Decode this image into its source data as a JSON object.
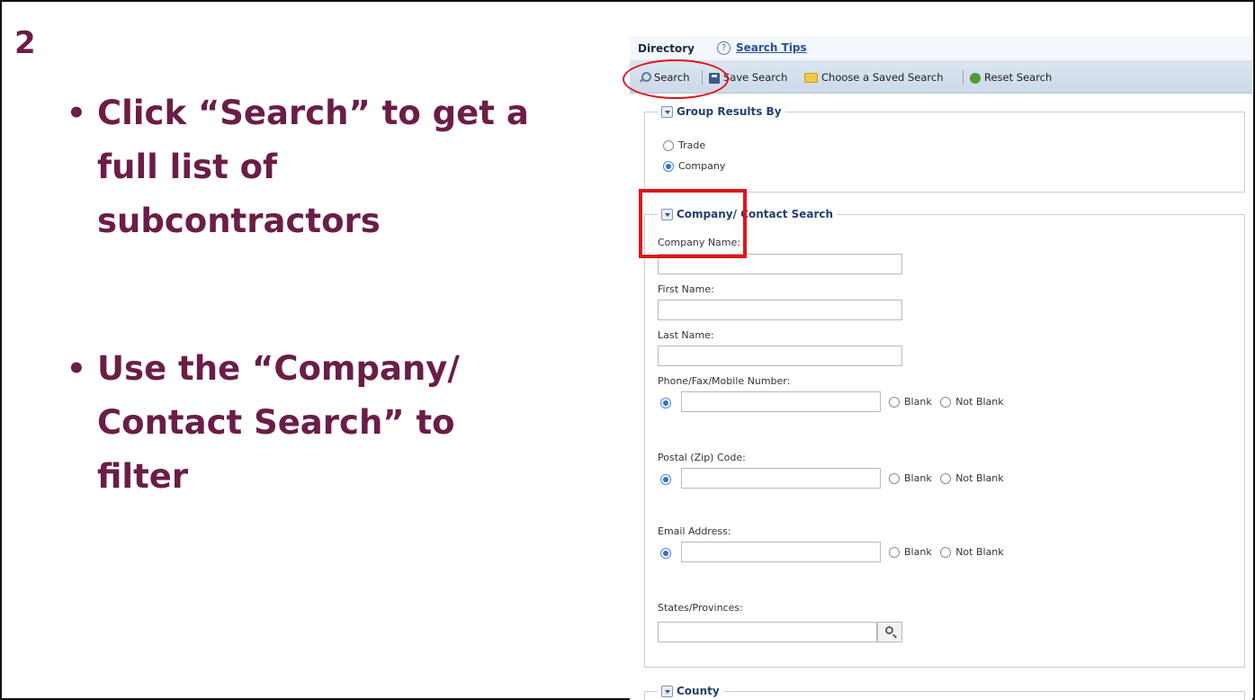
{
  "slide": {
    "step_number": "2",
    "bullets": [
      "Click “Search” to get a full list of subcontractors",
      "Use the “Company/ Contact Search” to filter"
    ]
  },
  "directory": {
    "title": "Directory",
    "tips_link": "Search Tips",
    "toolbar": {
      "search": "Search",
      "save_search": "Save Search",
      "choose_saved": "Choose a Saved Search",
      "reset_search": "Reset Search"
    },
    "group_results": {
      "legend": "Group Results By",
      "options": [
        {
          "label": "Trade",
          "selected": false
        },
        {
          "label": "Company",
          "selected": true
        }
      ]
    },
    "company_contact": {
      "legend": "Company/ Contact Search",
      "company_name_label": "Company Name:",
      "first_name_label": "First Name:",
      "last_name_label": "Last Name:",
      "phone_label": "Phone/Fax/Mobile Number:",
      "postal_label": "Postal (Zip) Code:",
      "email_label": "Email Address:",
      "states_label": "States/Provinces:",
      "blank_label": "Blank",
      "not_blank_label": "Not Blank"
    },
    "county": {
      "legend": "County"
    }
  },
  "colors": {
    "slide_text": "#6b1d47",
    "annotation_red": "#e0141a",
    "link_blue": "#27509b"
  },
  "icons": [
    "help-icon",
    "search-icon",
    "save-icon",
    "folder-icon",
    "reset-icon",
    "collapse-icon",
    "magnifier-icon"
  ]
}
